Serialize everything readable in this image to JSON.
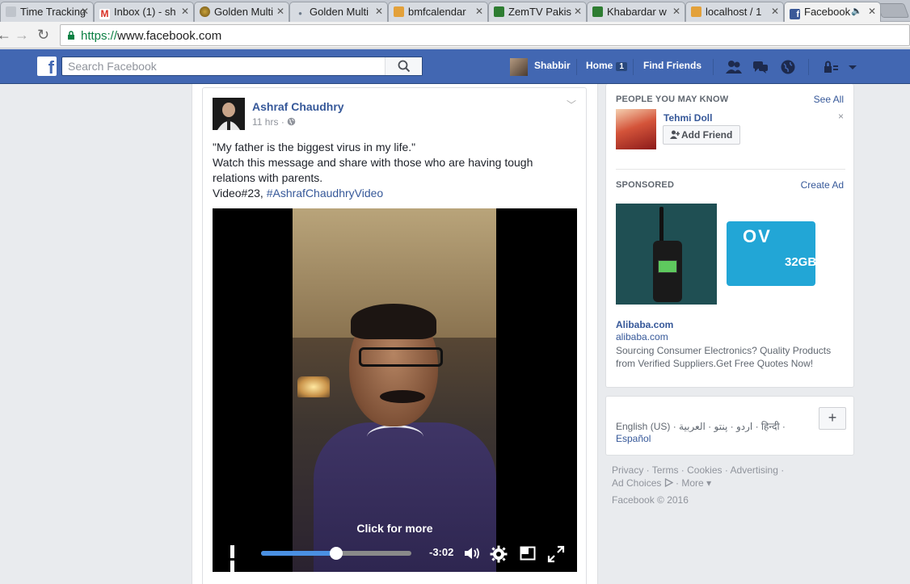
{
  "tabs": [
    {
      "title": "Time Tracking",
      "icon": "document-icon",
      "color": "#bfc4cb"
    },
    {
      "title": "Inbox (1) - sh",
      "icon": "gmail-icon",
      "color": "#d93025"
    },
    {
      "title": "Golden Multi",
      "icon": "golden-coin-icon",
      "color": "#8a6d1e"
    },
    {
      "title": "Golden Multi",
      "icon": "loading-dot-icon",
      "color": "#6d7a8a"
    },
    {
      "title": "bmfcalendar",
      "icon": "pma-icon",
      "color": "#e3a13a"
    },
    {
      "title": "ZemTV Pakis",
      "icon": "zemtv-icon",
      "color": "#2e7d32"
    },
    {
      "title": "Khabardar w",
      "icon": "zemtv-icon",
      "color": "#2e7d32"
    },
    {
      "title": "localhost / 1",
      "icon": "pma-icon",
      "color": "#e3a13a"
    },
    {
      "title": "Facebook",
      "icon": "facebook-icon",
      "color": "#3b5998",
      "active": true
    }
  ],
  "browser": {
    "url_scheme": "https://",
    "url_host": "www.facebook.com"
  },
  "fb": {
    "logo": "f",
    "search_placeholder": "Search Facebook",
    "user_name": "Shabbir",
    "home_label": "Home",
    "home_badge": "1",
    "find_friends": "Find Friends",
    "brand_color": "#4267b2"
  },
  "post": {
    "author": "Ashraf Chaudhry",
    "time": "11 hrs",
    "meta_sep": "·",
    "text_lines": [
      "\"My father is the biggest virus in my life.\"",
      "Watch this message and share with those who are having tough relations with parents."
    ],
    "video_label": "Video#23,",
    "hashtag": "#AshrafChaudhryVideo",
    "video": {
      "overlay_text": "Click for more",
      "time_remaining": "-3:02",
      "progress": 0.5
    }
  },
  "sidebar": {
    "pymk_title": "PEOPLE YOU MAY KNOW",
    "see_all": "See All",
    "person_name": "Tehmi Doll",
    "add_friend": "Add Friend",
    "close": "×",
    "sponsored_title": "SPONSORED",
    "create_ad": "Create Ad",
    "ad_title": "Alibaba.com",
    "ad_domain": "alibaba.com",
    "ad_desc": "Sourcing Consumer Electronics? Quality Products from Verified Suppliers.Get Free Quotes Now!",
    "ad_sd_brand": "OV",
    "ad_sd_text": "32GB"
  },
  "languages": {
    "current": "English (US)",
    "others": [
      "اردو",
      "پنتو",
      "العربية",
      "हिन्दी"
    ],
    "espanol": "Español",
    "plus": "+"
  },
  "footer": {
    "links": [
      "Privacy",
      "Terms",
      "Cookies",
      "Advertising",
      "Ad Choices",
      "More"
    ],
    "copyright": "Facebook © 2016"
  }
}
